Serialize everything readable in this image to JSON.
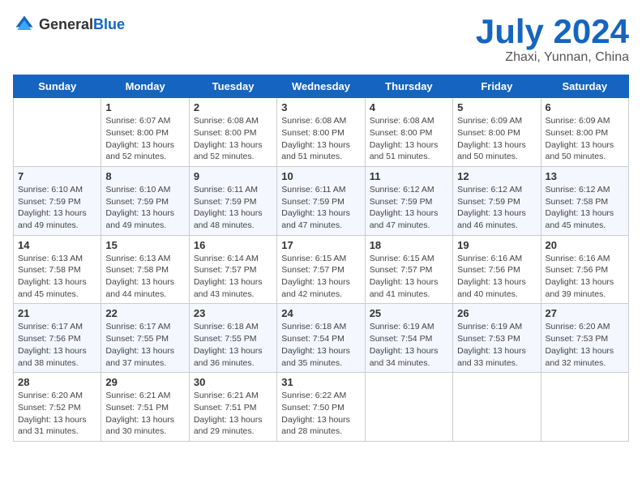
{
  "header": {
    "logo_general": "General",
    "logo_blue": "Blue",
    "month_year": "July 2024",
    "location": "Zhaxi, Yunnan, China"
  },
  "days_of_week": [
    "Sunday",
    "Monday",
    "Tuesday",
    "Wednesday",
    "Thursday",
    "Friday",
    "Saturday"
  ],
  "weeks": [
    [
      {
        "day": "",
        "sunrise": "",
        "sunset": "",
        "daylight": ""
      },
      {
        "day": "1",
        "sunrise": "Sunrise: 6:07 AM",
        "sunset": "Sunset: 8:00 PM",
        "daylight": "Daylight: 13 hours and 52 minutes."
      },
      {
        "day": "2",
        "sunrise": "Sunrise: 6:08 AM",
        "sunset": "Sunset: 8:00 PM",
        "daylight": "Daylight: 13 hours and 52 minutes."
      },
      {
        "day": "3",
        "sunrise": "Sunrise: 6:08 AM",
        "sunset": "Sunset: 8:00 PM",
        "daylight": "Daylight: 13 hours and 51 minutes."
      },
      {
        "day": "4",
        "sunrise": "Sunrise: 6:08 AM",
        "sunset": "Sunset: 8:00 PM",
        "daylight": "Daylight: 13 hours and 51 minutes."
      },
      {
        "day": "5",
        "sunrise": "Sunrise: 6:09 AM",
        "sunset": "Sunset: 8:00 PM",
        "daylight": "Daylight: 13 hours and 50 minutes."
      },
      {
        "day": "6",
        "sunrise": "Sunrise: 6:09 AM",
        "sunset": "Sunset: 8:00 PM",
        "daylight": "Daylight: 13 hours and 50 minutes."
      }
    ],
    [
      {
        "day": "7",
        "sunrise": "Sunrise: 6:10 AM",
        "sunset": "Sunset: 7:59 PM",
        "daylight": "Daylight: 13 hours and 49 minutes."
      },
      {
        "day": "8",
        "sunrise": "Sunrise: 6:10 AM",
        "sunset": "Sunset: 7:59 PM",
        "daylight": "Daylight: 13 hours and 49 minutes."
      },
      {
        "day": "9",
        "sunrise": "Sunrise: 6:11 AM",
        "sunset": "Sunset: 7:59 PM",
        "daylight": "Daylight: 13 hours and 48 minutes."
      },
      {
        "day": "10",
        "sunrise": "Sunrise: 6:11 AM",
        "sunset": "Sunset: 7:59 PM",
        "daylight": "Daylight: 13 hours and 47 minutes."
      },
      {
        "day": "11",
        "sunrise": "Sunrise: 6:12 AM",
        "sunset": "Sunset: 7:59 PM",
        "daylight": "Daylight: 13 hours and 47 minutes."
      },
      {
        "day": "12",
        "sunrise": "Sunrise: 6:12 AM",
        "sunset": "Sunset: 7:59 PM",
        "daylight": "Daylight: 13 hours and 46 minutes."
      },
      {
        "day": "13",
        "sunrise": "Sunrise: 6:12 AM",
        "sunset": "Sunset: 7:58 PM",
        "daylight": "Daylight: 13 hours and 45 minutes."
      }
    ],
    [
      {
        "day": "14",
        "sunrise": "Sunrise: 6:13 AM",
        "sunset": "Sunset: 7:58 PM",
        "daylight": "Daylight: 13 hours and 45 minutes."
      },
      {
        "day": "15",
        "sunrise": "Sunrise: 6:13 AM",
        "sunset": "Sunset: 7:58 PM",
        "daylight": "Daylight: 13 hours and 44 minutes."
      },
      {
        "day": "16",
        "sunrise": "Sunrise: 6:14 AM",
        "sunset": "Sunset: 7:57 PM",
        "daylight": "Daylight: 13 hours and 43 minutes."
      },
      {
        "day": "17",
        "sunrise": "Sunrise: 6:15 AM",
        "sunset": "Sunset: 7:57 PM",
        "daylight": "Daylight: 13 hours and 42 minutes."
      },
      {
        "day": "18",
        "sunrise": "Sunrise: 6:15 AM",
        "sunset": "Sunset: 7:57 PM",
        "daylight": "Daylight: 13 hours and 41 minutes."
      },
      {
        "day": "19",
        "sunrise": "Sunrise: 6:16 AM",
        "sunset": "Sunset: 7:56 PM",
        "daylight": "Daylight: 13 hours and 40 minutes."
      },
      {
        "day": "20",
        "sunrise": "Sunrise: 6:16 AM",
        "sunset": "Sunset: 7:56 PM",
        "daylight": "Daylight: 13 hours and 39 minutes."
      }
    ],
    [
      {
        "day": "21",
        "sunrise": "Sunrise: 6:17 AM",
        "sunset": "Sunset: 7:56 PM",
        "daylight": "Daylight: 13 hours and 38 minutes."
      },
      {
        "day": "22",
        "sunrise": "Sunrise: 6:17 AM",
        "sunset": "Sunset: 7:55 PM",
        "daylight": "Daylight: 13 hours and 37 minutes."
      },
      {
        "day": "23",
        "sunrise": "Sunrise: 6:18 AM",
        "sunset": "Sunset: 7:55 PM",
        "daylight": "Daylight: 13 hours and 36 minutes."
      },
      {
        "day": "24",
        "sunrise": "Sunrise: 6:18 AM",
        "sunset": "Sunset: 7:54 PM",
        "daylight": "Daylight: 13 hours and 35 minutes."
      },
      {
        "day": "25",
        "sunrise": "Sunrise: 6:19 AM",
        "sunset": "Sunset: 7:54 PM",
        "daylight": "Daylight: 13 hours and 34 minutes."
      },
      {
        "day": "26",
        "sunrise": "Sunrise: 6:19 AM",
        "sunset": "Sunset: 7:53 PM",
        "daylight": "Daylight: 13 hours and 33 minutes."
      },
      {
        "day": "27",
        "sunrise": "Sunrise: 6:20 AM",
        "sunset": "Sunset: 7:53 PM",
        "daylight": "Daylight: 13 hours and 32 minutes."
      }
    ],
    [
      {
        "day": "28",
        "sunrise": "Sunrise: 6:20 AM",
        "sunset": "Sunset: 7:52 PM",
        "daylight": "Daylight: 13 hours and 31 minutes."
      },
      {
        "day": "29",
        "sunrise": "Sunrise: 6:21 AM",
        "sunset": "Sunset: 7:51 PM",
        "daylight": "Daylight: 13 hours and 30 minutes."
      },
      {
        "day": "30",
        "sunrise": "Sunrise: 6:21 AM",
        "sunset": "Sunset: 7:51 PM",
        "daylight": "Daylight: 13 hours and 29 minutes."
      },
      {
        "day": "31",
        "sunrise": "Sunrise: 6:22 AM",
        "sunset": "Sunset: 7:50 PM",
        "daylight": "Daylight: 13 hours and 28 minutes."
      },
      {
        "day": "",
        "sunrise": "",
        "sunset": "",
        "daylight": ""
      },
      {
        "day": "",
        "sunrise": "",
        "sunset": "",
        "daylight": ""
      },
      {
        "day": "",
        "sunrise": "",
        "sunset": "",
        "daylight": ""
      }
    ]
  ]
}
